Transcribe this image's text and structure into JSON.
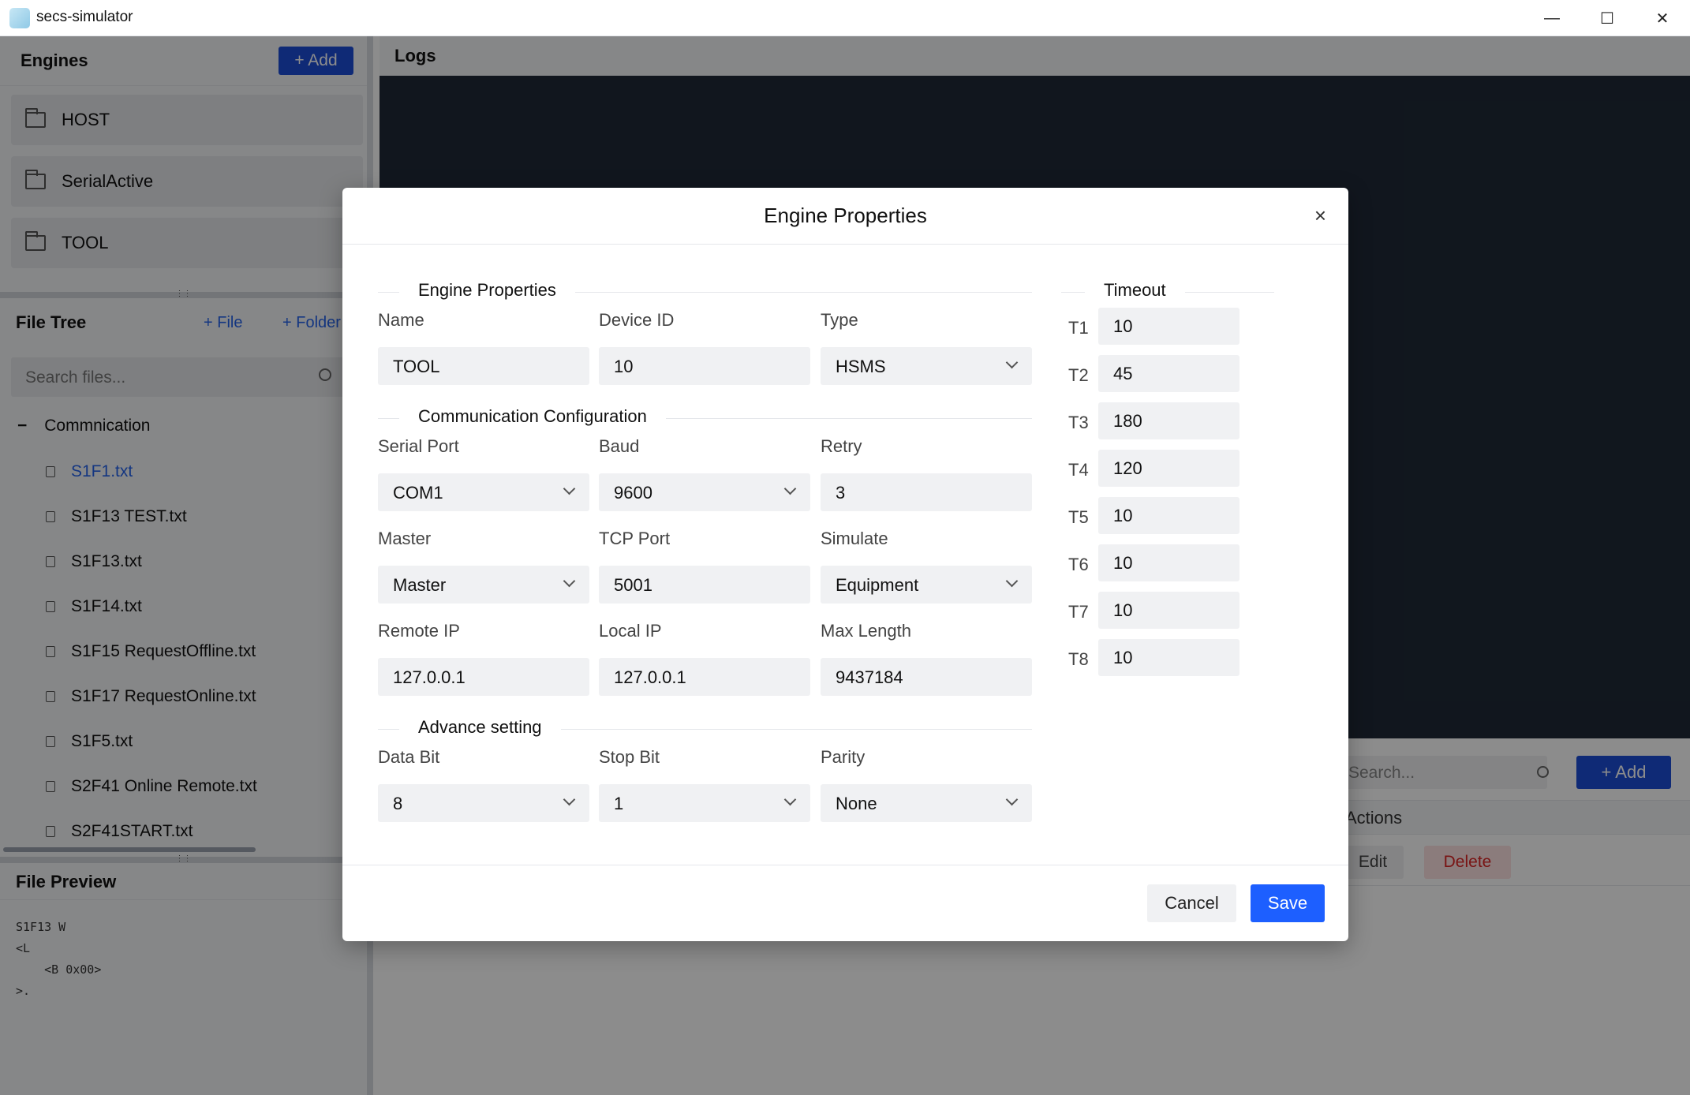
{
  "window": {
    "title": "secs-simulator",
    "minimize": "—",
    "maximize": "☐",
    "close": "✕"
  },
  "engines": {
    "title": "Engines",
    "add_label": "+ Add",
    "items": [
      "HOST",
      "SerialActive",
      "TOOL"
    ]
  },
  "file_tree": {
    "title": "File Tree",
    "add_file": "+ File",
    "add_folder": "+ Folder",
    "search_placeholder": "Search files...",
    "folder": "Commnication",
    "folder_toggle": "−",
    "files": [
      "S1F1.txt",
      "S1F13 TEST.txt",
      "S1F13.txt",
      "S1F14.txt",
      "S1F15 RequestOffline.txt",
      "S1F17 RequestOnline.txt",
      "S1F5.txt",
      "S2F41 Online Remote.txt",
      "S2F41START.txt"
    ],
    "selected_file": "S1F1.txt"
  },
  "file_preview": {
    "title": "File Preview",
    "content": "S1F13 W\n<L\n    <B 0x00>\n>."
  },
  "logs": {
    "title": "Logs"
  },
  "messages": {
    "search_placeholder": "Search...",
    "add_label": "+ Add",
    "actions_header": "Actions",
    "edit_label": "Edit",
    "delete_label": "Delete"
  },
  "modal": {
    "title": "Engine Properties",
    "close": "×",
    "section_engine": "Engine Properties",
    "section_comm": "Communication Configuration",
    "section_adv": "Advance setting",
    "section_timeout": "Timeout",
    "fields": {
      "name": {
        "label": "Name",
        "value": "TOOL"
      },
      "device_id": {
        "label": "Device ID",
        "value": "10"
      },
      "type": {
        "label": "Type",
        "value": "HSMS"
      },
      "serial_port": {
        "label": "Serial Port",
        "value": "COM1"
      },
      "baud": {
        "label": "Baud",
        "value": "9600"
      },
      "retry": {
        "label": "Retry",
        "value": "3"
      },
      "master": {
        "label": "Master",
        "value": "Master"
      },
      "tcp_port": {
        "label": "TCP Port",
        "value": "5001"
      },
      "simulate": {
        "label": "Simulate",
        "value": "Equipment"
      },
      "remote_ip": {
        "label": "Remote IP",
        "value": "127.0.0.1"
      },
      "local_ip": {
        "label": "Local IP",
        "value": "127.0.0.1"
      },
      "max_length": {
        "label": "Max Length",
        "value": "9437184"
      },
      "data_bit": {
        "label": "Data Bit",
        "value": "8"
      },
      "stop_bit": {
        "label": "Stop Bit",
        "value": "1"
      },
      "parity": {
        "label": "Parity",
        "value": "None"
      }
    },
    "timeouts": [
      {
        "label": "T1",
        "value": "10"
      },
      {
        "label": "T2",
        "value": "45"
      },
      {
        "label": "T3",
        "value": "180"
      },
      {
        "label": "T4",
        "value": "120"
      },
      {
        "label": "T5",
        "value": "10"
      },
      {
        "label": "T6",
        "value": "10"
      },
      {
        "label": "T7",
        "value": "10"
      },
      {
        "label": "T8",
        "value": "10"
      }
    ],
    "cancel_label": "Cancel",
    "save_label": "Save"
  },
  "colors": {
    "accent": "#1d5fff",
    "button_blue": "#1d4ed8",
    "logs_bg": "#1f2937",
    "delete_red": "#dc2626"
  }
}
